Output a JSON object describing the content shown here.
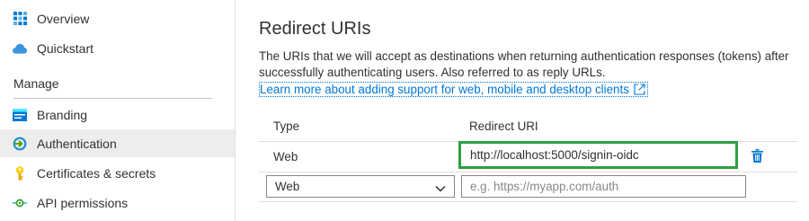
{
  "sidebar": {
    "items_top": [
      {
        "label": "Overview",
        "icon": "grid-icon"
      },
      {
        "label": "Quickstart",
        "icon": "cloud-icon"
      }
    ],
    "section_label": "Manage",
    "items_manage": [
      {
        "label": "Branding",
        "icon": "branding-icon"
      },
      {
        "label": "Authentication",
        "icon": "authentication-icon",
        "active": true
      },
      {
        "label": "Certificates & secrets",
        "icon": "key-icon"
      },
      {
        "label": "API permissions",
        "icon": "api-permissions-icon"
      }
    ]
  },
  "main": {
    "title": "Redirect URIs",
    "description": "The URIs that we will accept as destinations when returning authentication responses (tokens) after successfully authenticating users. Also referred to as reply URLs.",
    "learn_more_link": "Learn more about adding support for web, mobile and desktop clients",
    "table": {
      "headers": {
        "type": "Type",
        "redirect_uri": "Redirect URI"
      },
      "rows": [
        {
          "type": "Web",
          "uri": "http://localhost:5000/signin-oidc"
        }
      ],
      "new_row": {
        "type_selected": "Web",
        "uri_placeholder": "e.g. https://myapp.com/auth"
      }
    }
  },
  "colors": {
    "accent": "#0078d4",
    "highlight_border": "#2ea043",
    "active_nav_bg": "#eeedec"
  }
}
